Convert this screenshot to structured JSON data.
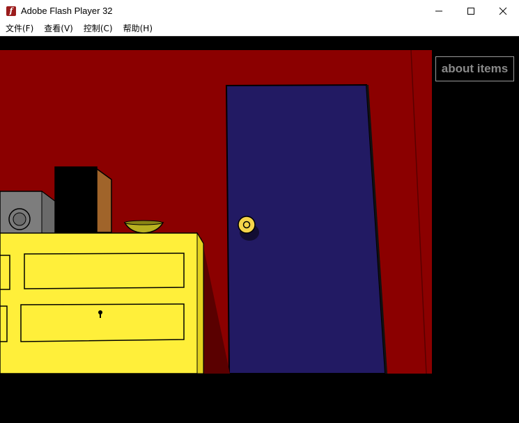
{
  "window": {
    "title": "Adobe Flash Player 32",
    "icon": "flash-player-icon",
    "icon_glyph": "f"
  },
  "menu": {
    "items": [
      "文件(F)",
      "查看(V)",
      "控制(C)",
      "帮助(H)"
    ]
  },
  "game": {
    "about_button_label": "about items",
    "colors": {
      "wall": "#8b0000",
      "door": "#221a63",
      "dresser": "#ffef3a",
      "knob": "#f5d44a",
      "background": "#000000"
    }
  }
}
